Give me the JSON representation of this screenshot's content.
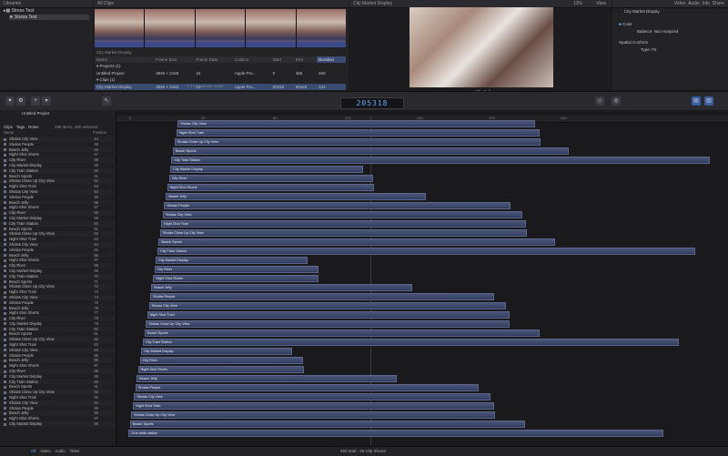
{
  "libraries": {
    "header": "Libraries",
    "items": [
      "Stress Test",
      "Stress Test"
    ]
  },
  "browser": {
    "header": "All Clips",
    "filmstrip_caption": "City Market Display",
    "columns": [
      "Name",
      "Frame Size",
      "Frame Rate",
      "Codecs",
      "Start",
      "End",
      "Duration"
    ],
    "groups": [
      {
        "label": "Projects",
        "count": "(1)"
      },
      {
        "label": "Clips",
        "count": "(1)"
      }
    ],
    "rows": [
      [
        "Untitled Project",
        "3840 × 2160",
        "24",
        "Apple Pro...",
        "0",
        "460",
        "460"
      ],
      [
        "City Market Display",
        "3840 × 2160",
        "24",
        "Apple Pro...",
        "00316",
        "00440",
        "123"
      ]
    ],
    "footer": "1 of 14 selected, 04:09"
  },
  "viewer": {
    "header": "City Market Display",
    "zoom": "13%",
    "view_label": "View"
  },
  "inspector": {
    "tabs": [
      "Video",
      "Audio",
      "Info",
      "Share"
    ],
    "clip_name": "City Market Display",
    "section_color": "Color",
    "balance_label": "Balance:",
    "balance_value": "Not Analyzed",
    "section_spatial": "Spatial Conform",
    "type_label": "Type:",
    "type_value": "Fit"
  },
  "timeline": {
    "timecode": "205318",
    "project_name": "Untitled Project",
    "ruler_ticks": [
      "0",
      "40",
      "80",
      "120",
      "160",
      "200",
      "240"
    ]
  },
  "index": {
    "tabs": [
      "Clips",
      "Tags",
      "Roles"
    ],
    "summary": "185 items, 380 selected",
    "col_name": "Name",
    "col_position": "Position",
    "rows": [
      [
        "Sholas City View",
        "44"
      ],
      [
        "Sholas People",
        "45"
      ],
      [
        "Beach Jelly",
        "46"
      ],
      [
        "Night Shot Shorts",
        "47"
      ],
      [
        "City River",
        "48"
      ],
      [
        "City Market Display",
        "49"
      ],
      [
        "City Train Station",
        "50"
      ],
      [
        "Beach Sports",
        "51"
      ],
      [
        "Sholas Close Up City View",
        "52"
      ],
      [
        "Night Shot Train",
        "53"
      ],
      [
        "Sholas City View",
        "54"
      ],
      [
        "Sholas People",
        "55"
      ],
      [
        "Beach Jelly",
        "56"
      ],
      [
        "Night Shot Shorts",
        "57"
      ],
      [
        "City River",
        "58"
      ],
      [
        "City Market Display",
        "59"
      ],
      [
        "City Train Station",
        "60"
      ],
      [
        "Beach Sports",
        "61"
      ],
      [
        "Sholas Close Up City View",
        "62"
      ],
      [
        "Night Shot Train",
        "63"
      ],
      [
        "Sholas City View",
        "64"
      ],
      [
        "Sholas People",
        "65"
      ],
      [
        "Beach Jelly",
        "66"
      ],
      [
        "Night Shot Shorts",
        "67"
      ],
      [
        "City River",
        "68"
      ],
      [
        "City Market Display",
        "69"
      ],
      [
        "City Train Station",
        "70"
      ],
      [
        "Beach Sports",
        "71"
      ],
      [
        "Sholas Close Up City View",
        "72"
      ],
      [
        "Night Shot Train",
        "73"
      ],
      [
        "Sholas City View",
        "74"
      ],
      [
        "Sholas People",
        "75"
      ],
      [
        "Beach Jelly",
        "76"
      ],
      [
        "Night Shot Shorts",
        "77"
      ],
      [
        "City River",
        "78"
      ],
      [
        "City Market Display",
        "79"
      ],
      [
        "City Train Station",
        "80"
      ],
      [
        "Beach Sports",
        "81"
      ],
      [
        "Sholas Close Up City View",
        "82"
      ],
      [
        "Night Shot Train",
        "83"
      ],
      [
        "Sholas City View",
        "84"
      ],
      [
        "Sholas People",
        "85"
      ],
      [
        "Beach Jelly",
        "86"
      ],
      [
        "Night Shot Shorts",
        "87"
      ],
      [
        "City River",
        "88"
      ],
      [
        "City Market Display",
        "89"
      ],
      [
        "City Train Station",
        "90"
      ],
      [
        "Beach Sports",
        "91"
      ],
      [
        "Sholas Close Up City View",
        "92"
      ],
      [
        "Night Shot Train",
        "93"
      ],
      [
        "Sholas City View",
        "94"
      ],
      [
        "Sholas People",
        "95"
      ],
      [
        "Beach Jelly",
        "96"
      ],
      [
        "Night Shot Shorts",
        "97"
      ],
      [
        "City Market Display",
        "98"
      ]
    ],
    "bottom_tabs": [
      "All",
      "Video",
      "Audio",
      "Titles"
    ]
  },
  "clips": [
    {
      "label": "Sholas City View",
      "start": 0.1,
      "end": 0.685
    },
    {
      "label": "Night Shot Train",
      "start": 0.098,
      "end": 0.692
    },
    {
      "label": "Sholas Close Up City View",
      "start": 0.095,
      "end": 0.693
    },
    {
      "label": "Beach Sports",
      "start": 0.092,
      "end": 0.74
    },
    {
      "label": "City Train Station",
      "start": 0.09,
      "end": 0.97
    },
    {
      "label": "City Market Display",
      "start": 0.088,
      "end": 0.403
    },
    {
      "label": "City River",
      "start": 0.086,
      "end": 0.42
    },
    {
      "label": "Night Shot Shorts",
      "start": 0.083,
      "end": 0.421
    },
    {
      "label": "Beach Jelly",
      "start": 0.081,
      "end": 0.506
    },
    {
      "label": "Sholas People",
      "start": 0.078,
      "end": 0.645
    },
    {
      "label": "Sholas City View",
      "start": 0.076,
      "end": 0.664
    },
    {
      "label": "Night Shot Train",
      "start": 0.073,
      "end": 0.67
    },
    {
      "label": "Sholas Close Up City View",
      "start": 0.071,
      "end": 0.671
    },
    {
      "label": "Beach Sports",
      "start": 0.069,
      "end": 0.718
    },
    {
      "label": "City Train Station",
      "start": 0.067,
      "end": 0.946
    },
    {
      "label": "City Market Display",
      "start": 0.064,
      "end": 0.313
    },
    {
      "label": "City River",
      "start": 0.062,
      "end": 0.33
    },
    {
      "label": "Night Shot Shorts",
      "start": 0.06,
      "end": 0.331
    },
    {
      "label": "Beach Jelly",
      "start": 0.057,
      "end": 0.484
    },
    {
      "label": "Sholas People",
      "start": 0.055,
      "end": 0.618
    },
    {
      "label": "Sholas City View",
      "start": 0.053,
      "end": 0.637
    },
    {
      "label": "Night Shot Train",
      "start": 0.05,
      "end": 0.643
    },
    {
      "label": "Sholas Close Up City View",
      "start": 0.048,
      "end": 0.643
    },
    {
      "label": "Beach Sports",
      "start": 0.046,
      "end": 0.692
    },
    {
      "label": "City Train Station",
      "start": 0.043,
      "end": 0.92
    },
    {
      "label": "City Market Display",
      "start": 0.04,
      "end": 0.287
    },
    {
      "label": "City River",
      "start": 0.038,
      "end": 0.305
    },
    {
      "label": "Night Shot Shorts",
      "start": 0.035,
      "end": 0.306
    },
    {
      "label": "Beach Jelly",
      "start": 0.033,
      "end": 0.458
    },
    {
      "label": "Sholas People",
      "start": 0.031,
      "end": 0.593
    },
    {
      "label": "Sholas City View",
      "start": 0.029,
      "end": 0.612
    },
    {
      "label": "Night Shot Train",
      "start": 0.027,
      "end": 0.618
    },
    {
      "label": "Sholas Close Up City View",
      "start": 0.024,
      "end": 0.619
    },
    {
      "label": "Beach Sports",
      "start": 0.022,
      "end": 0.668
    },
    {
      "label": "Line state station",
      "start": 0.02,
      "end": 0.895
    }
  ],
  "status_bar": {
    "text": "460 total - 46 Clip Shown"
  },
  "colors": {
    "accent": "#5fa8ff",
    "clip": "#3c4668"
  },
  "icons": [
    "library-icon",
    "magic-wand-icon",
    "play-icon",
    "gear-icon",
    "zoom-icon"
  ]
}
